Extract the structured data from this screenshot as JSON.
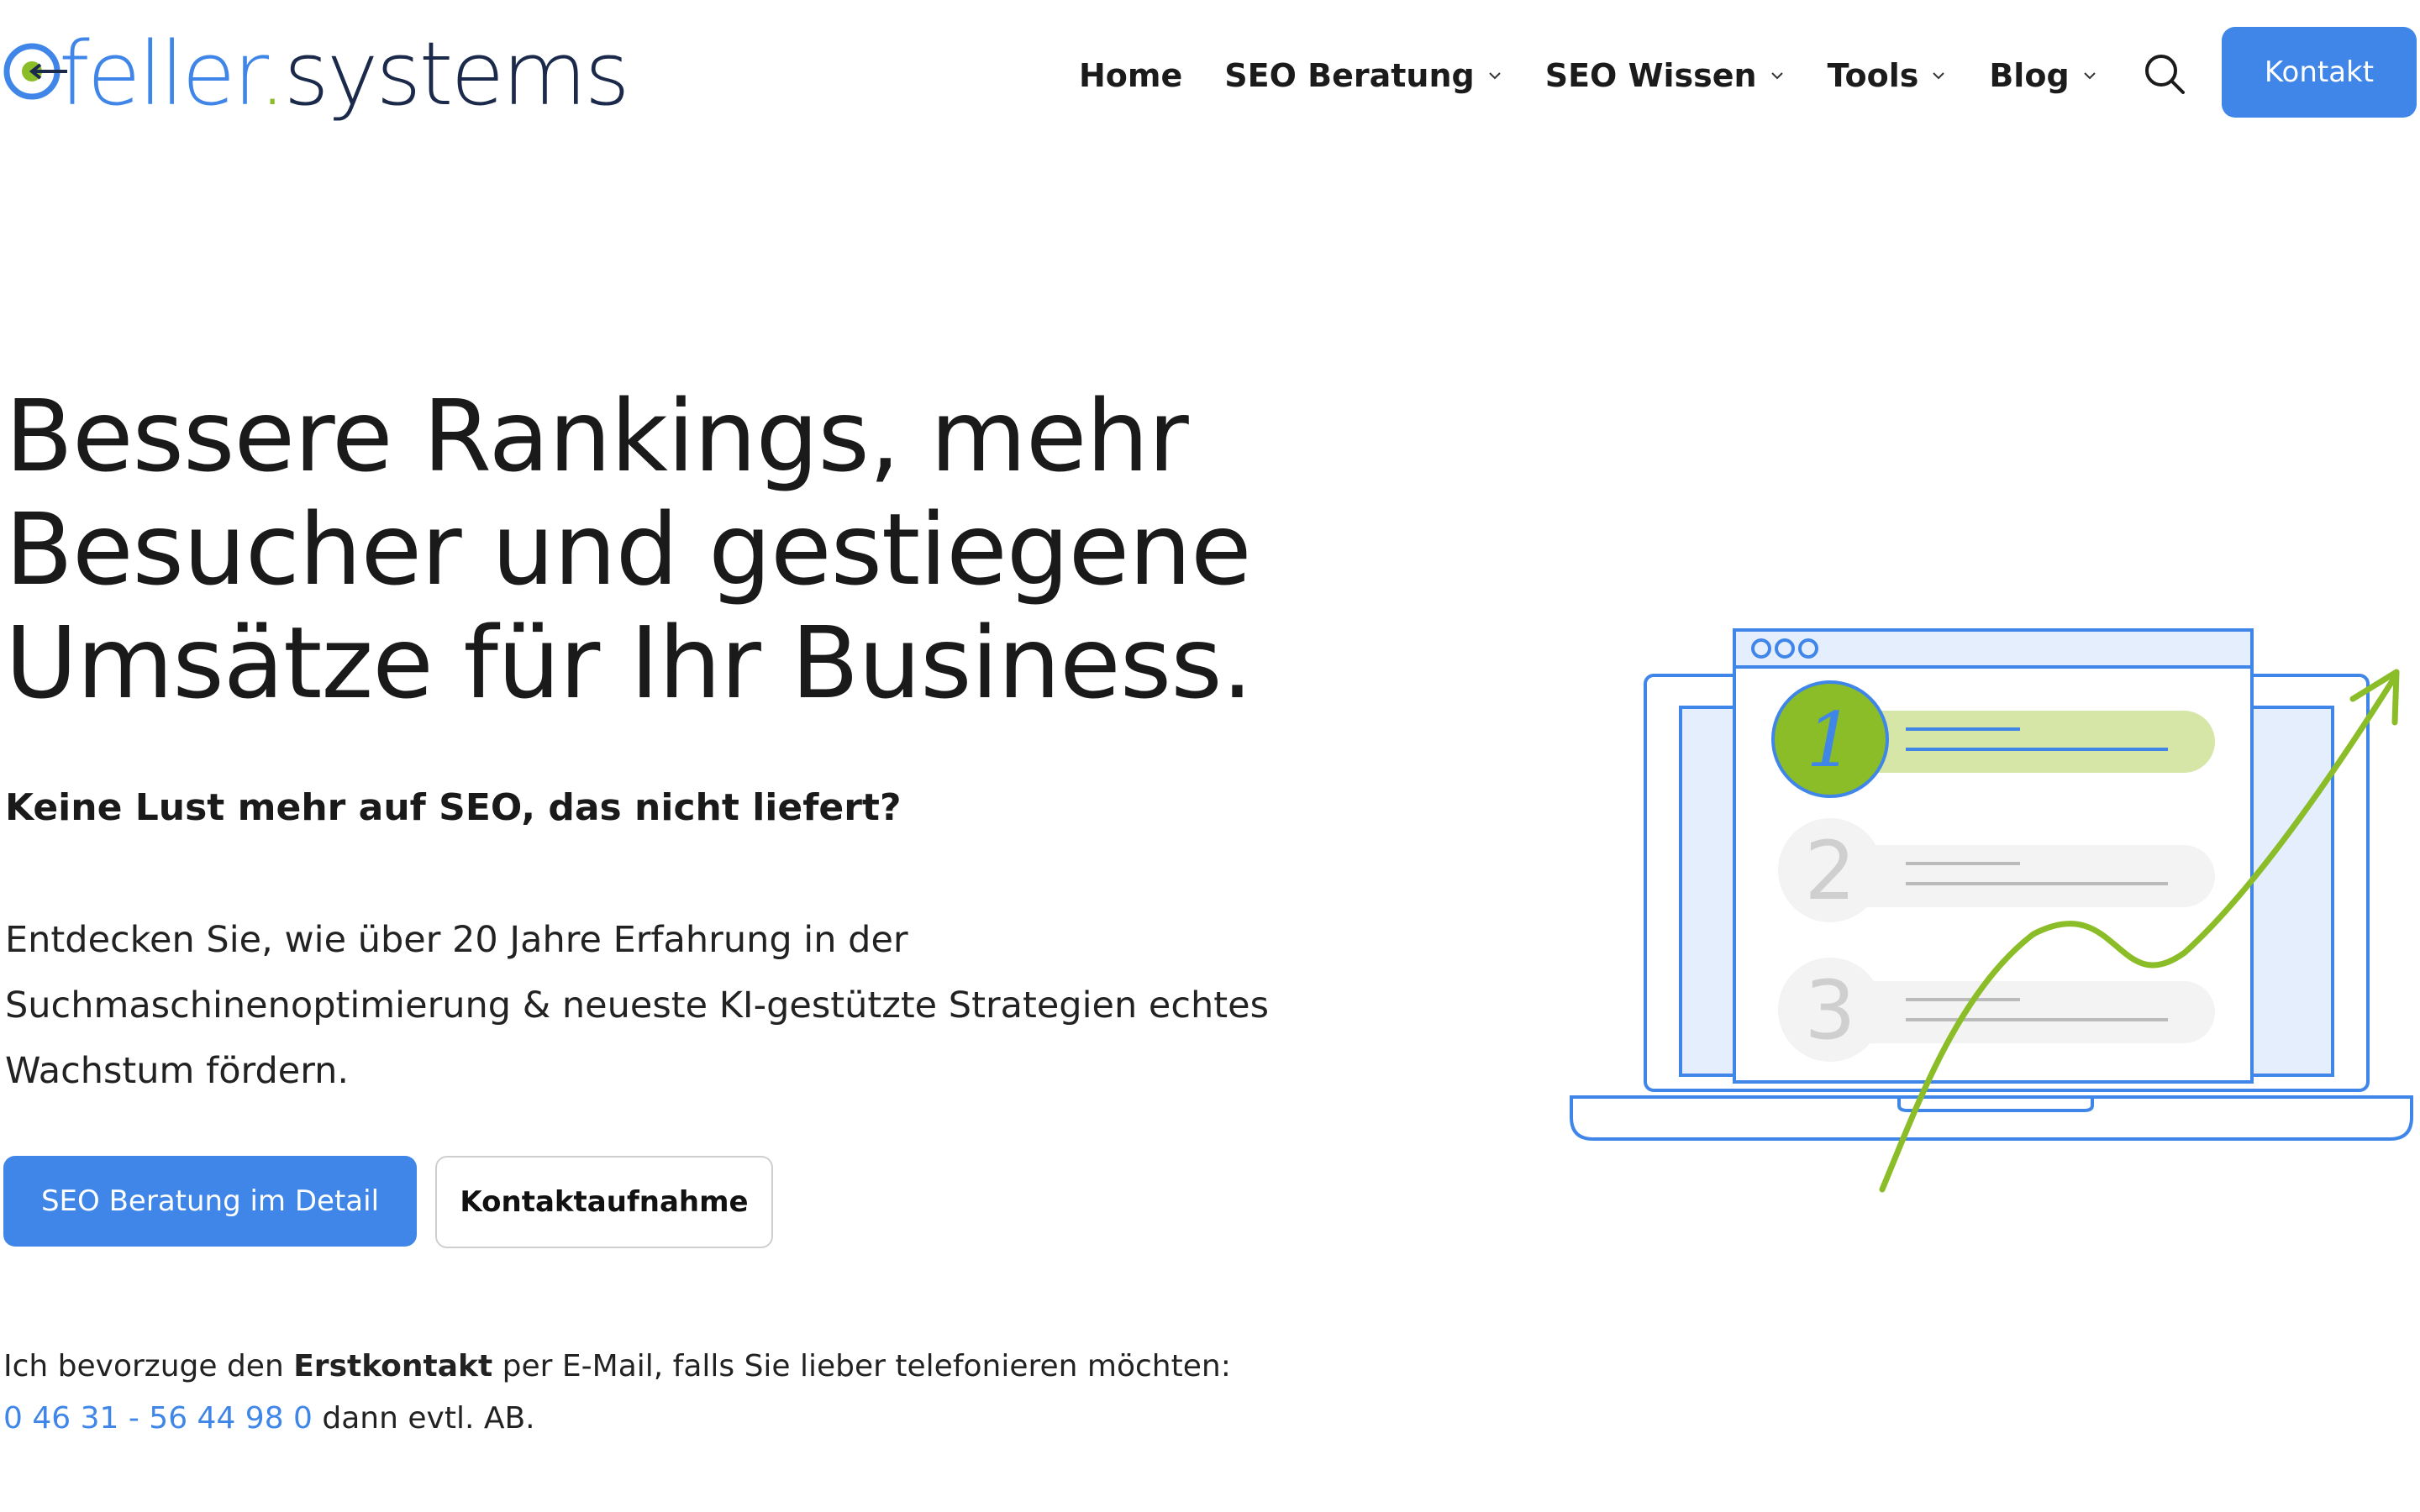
{
  "brand": {
    "logo_part1": "feller",
    "logo_dot": ".",
    "logo_part2": "systems"
  },
  "nav": {
    "items": [
      {
        "label": "Home",
        "has_dropdown": false
      },
      {
        "label": "SEO Beratung",
        "has_dropdown": true
      },
      {
        "label": "SEO Wissen",
        "has_dropdown": true
      },
      {
        "label": "Tools",
        "has_dropdown": true
      },
      {
        "label": "Blog",
        "has_dropdown": true
      }
    ],
    "search_icon": "search-icon",
    "cta_label": "Kontakt"
  },
  "hero": {
    "title_line1": "Bessere Rankings, mehr",
    "title_line2": "Besucher und gestiegene",
    "title_line3": "Umsätze für Ihr Business.",
    "subhead": "Keine Lust mehr auf SEO, das nicht liefert?",
    "lead_line1": "Entdecken Sie, wie über 20 Jahre Erfahrung in der",
    "lead_line2": "Suchmaschinenoptimierung & neueste KI-gestützte Strategien echtes",
    "lead_line3": "Wachstum fördern.",
    "primary_button": "SEO Beratung im Detail",
    "secondary_button": "Kontaktaufnahme"
  },
  "contact_note": {
    "text_before": "Ich bevorzuge den ",
    "bold": "Erstkontakt",
    "text_after": " per E-Mail, falls Sie lieber telefonieren möchten:",
    "phone": "0 46 31 - 56 44 98 0",
    "phone_suffix": " dann evtl. AB."
  },
  "illustration": {
    "ranks": [
      "1",
      "2",
      "3"
    ]
  },
  "colors": {
    "accent": "#3f86e8",
    "green": "#8bbd28",
    "text": "#1a1a1a"
  }
}
